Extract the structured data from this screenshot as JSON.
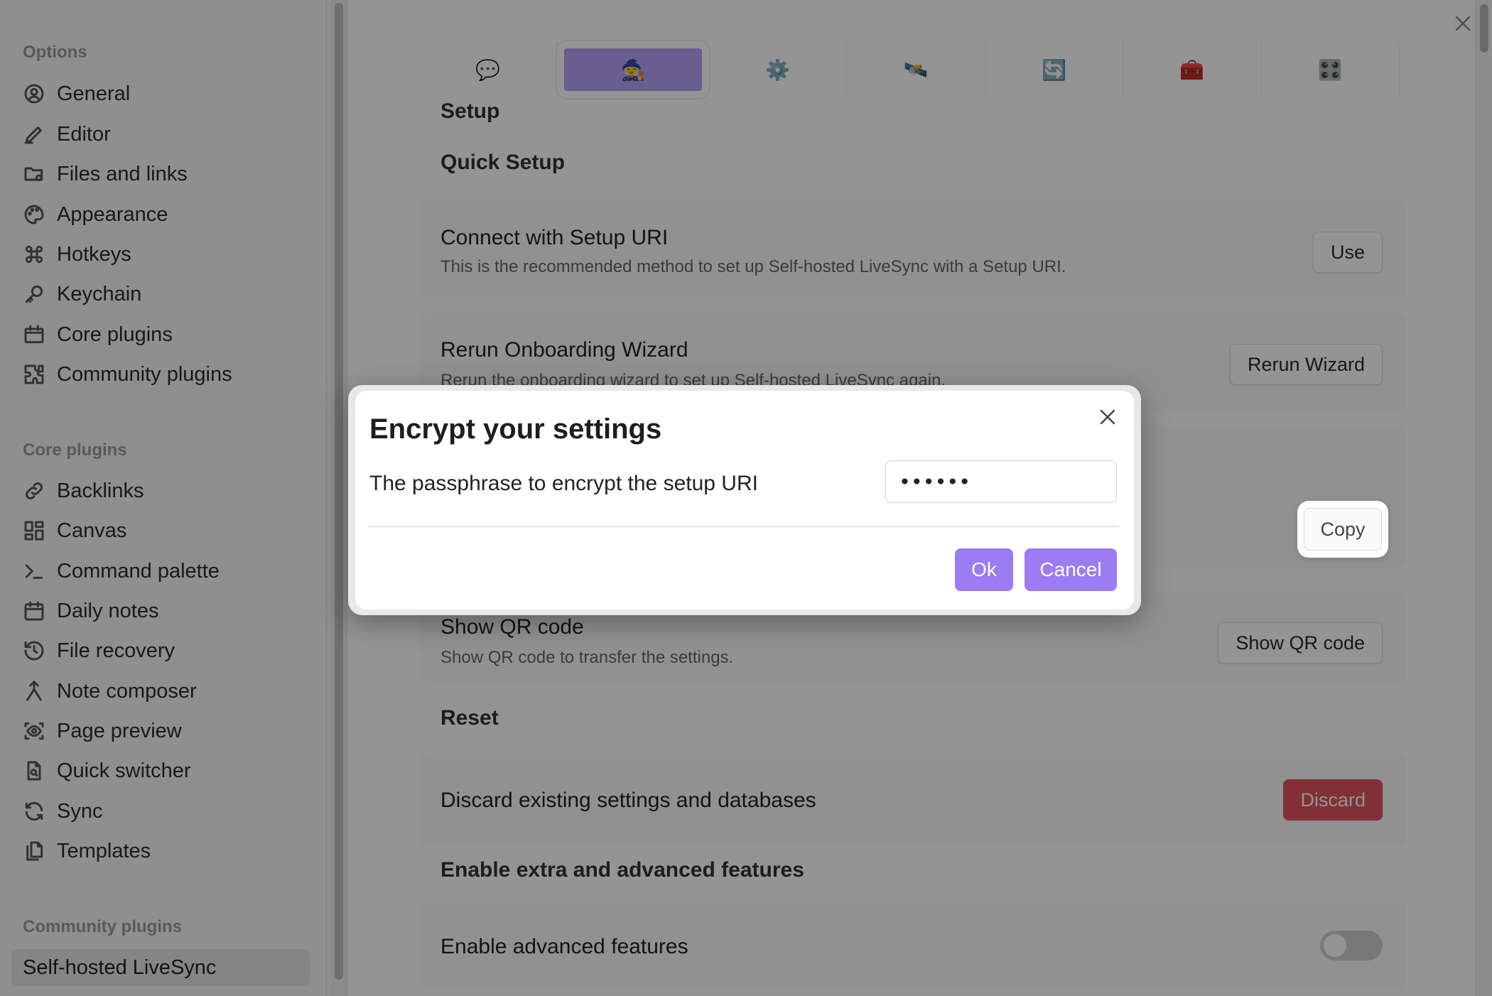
{
  "sidebar": {
    "sections": [
      {
        "title": "Options",
        "items": [
          {
            "label": "General",
            "icon": "user-circle-icon"
          },
          {
            "label": "Editor",
            "icon": "pencil-icon"
          },
          {
            "label": "Files and links",
            "icon": "folder-cog-icon"
          },
          {
            "label": "Appearance",
            "icon": "palette-icon"
          },
          {
            "label": "Hotkeys",
            "icon": "command-icon"
          },
          {
            "label": "Keychain",
            "icon": "key-icon"
          },
          {
            "label": "Core plugins",
            "icon": "calendar-box-icon"
          },
          {
            "label": "Community plugins",
            "icon": "puzzle-icon"
          }
        ]
      },
      {
        "title": "Core plugins",
        "items": [
          {
            "label": "Backlinks",
            "icon": "backlink-icon"
          },
          {
            "label": "Canvas",
            "icon": "canvas-icon"
          },
          {
            "label": "Command palette",
            "icon": "terminal-icon"
          },
          {
            "label": "Daily notes",
            "icon": "calendar-icon"
          },
          {
            "label": "File recovery",
            "icon": "history-icon"
          },
          {
            "label": "Note composer",
            "icon": "merge-icon"
          },
          {
            "label": "Page preview",
            "icon": "eye-frame-icon"
          },
          {
            "label": "Quick switcher",
            "icon": "file-search-icon"
          },
          {
            "label": "Sync",
            "icon": "sync-icon"
          },
          {
            "label": "Templates",
            "icon": "files-icon"
          }
        ]
      },
      {
        "title": "Community plugins",
        "items": [
          {
            "label": "Self-hosted LiveSync",
            "icon": "",
            "active": true
          }
        ]
      }
    ]
  },
  "tabs": [
    {
      "icon": "speech-bubble-icon",
      "glyph": "💬"
    },
    {
      "icon": "wizard-icon",
      "glyph": "🧙",
      "active": true
    },
    {
      "icon": "gear-icon",
      "glyph": "⚙️"
    },
    {
      "icon": "satellite-icon",
      "glyph": "🛰️"
    },
    {
      "icon": "sync-arrows-icon",
      "glyph": "🔄"
    },
    {
      "icon": "toolbox-icon",
      "glyph": "🧰"
    },
    {
      "icon": "apps-icon",
      "glyph": "🎛️"
    }
  ],
  "main": {
    "setup_heading": "Setup",
    "quick_setup_heading": "Quick Setup",
    "connect": {
      "name": "Connect with Setup URI",
      "desc": "This is the recommended method to set up Self-hosted LiveSync with a Setup URI.",
      "button": "Use"
    },
    "rerun": {
      "name": "Rerun Onboarding Wizard",
      "desc": "Rerun the onboarding wizard to set up Self-hosted LiveSync again.",
      "button": "Rerun Wizard"
    },
    "copy_button": "Copy",
    "qr": {
      "name": "Show QR code",
      "desc": "Show QR code to transfer the settings.",
      "button": "Show QR code"
    },
    "reset_heading": "Reset",
    "discard": {
      "name": "Discard existing settings and databases",
      "button": "Discard"
    },
    "extra_heading": "Enable extra and advanced features",
    "advanced": {
      "name": "Enable advanced features",
      "enabled": false
    }
  },
  "modal": {
    "title": "Encrypt your settings",
    "label": "The passphrase to encrypt the setup URI",
    "input_value": "••••••",
    "ok": "Ok",
    "cancel": "Cancel"
  },
  "colors": {
    "accent": "#9b7cf3",
    "danger": "#e0535f"
  }
}
